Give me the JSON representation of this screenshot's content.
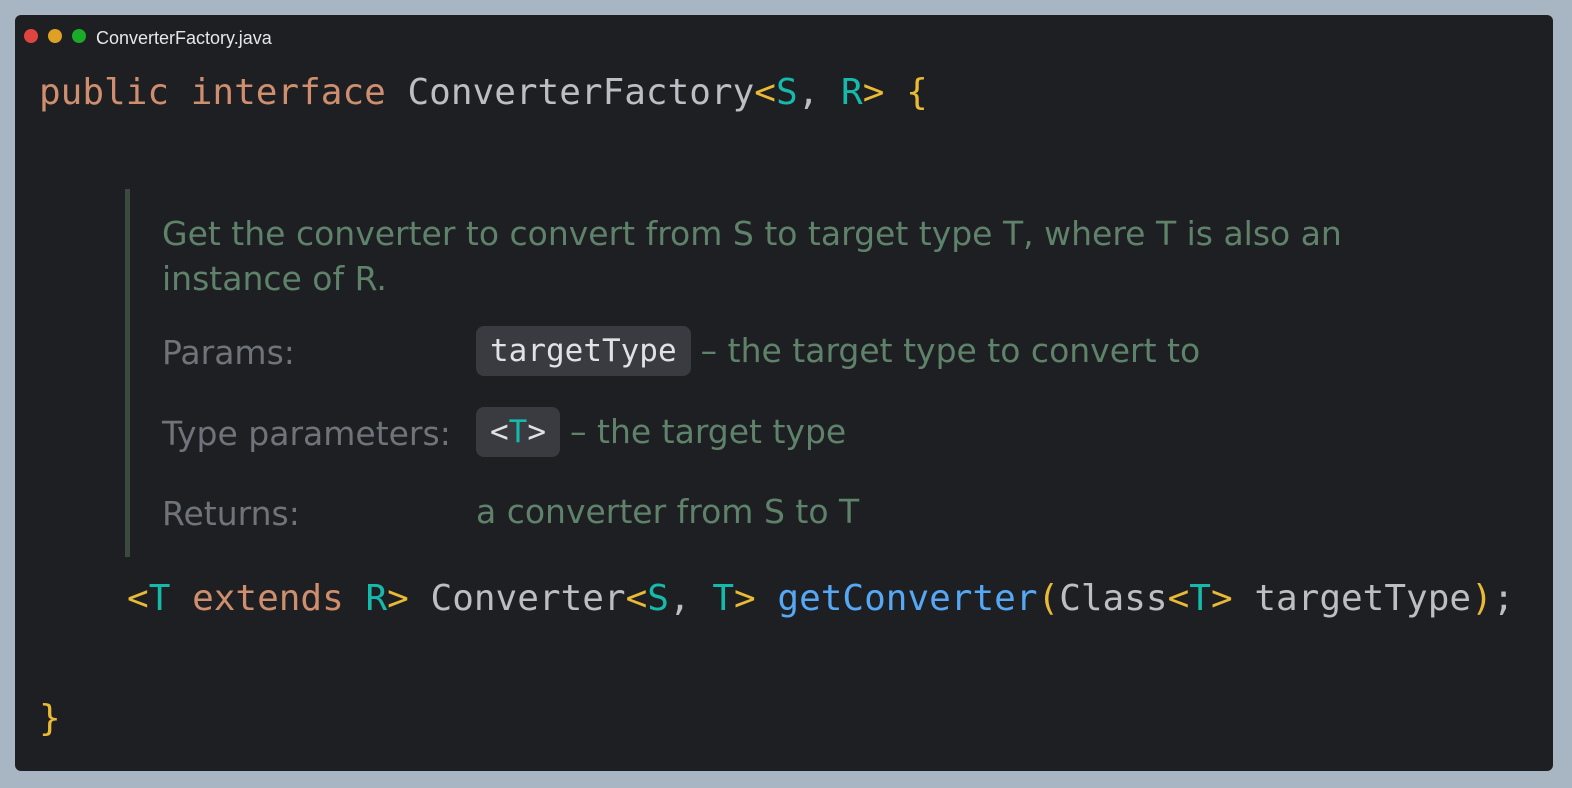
{
  "window": {
    "title": "ConverterFactory.java"
  },
  "code": {
    "line1": {
      "kw_public": "public",
      "kw_interface": "interface",
      "class_name": "ConverterFactory",
      "lt": "<",
      "type_s": "S",
      "comma": ", ",
      "type_r": "R",
      "gt": ">",
      "brace_open": "{"
    },
    "line2": {
      "lt1": "<",
      "type_t": "T",
      "kw_extends": "extends",
      "type_r": "R",
      "gt1": ">",
      "return_type": "Converter",
      "lt2": "<",
      "type_s": "S",
      "comma": ", ",
      "type_t2": "T",
      "gt2": ">",
      "method_name": "getConverter",
      "paren_open": "(",
      "param_type": "Class",
      "lt3": "<",
      "type_t3": "T",
      "gt3": ">",
      "param_name": "targetType",
      "paren_close": ")",
      "semicolon": ";"
    },
    "line3": {
      "brace_close": "}"
    }
  },
  "javadoc": {
    "description": "Get the converter to convert from S to target type T, where T is also an instance of R.",
    "params_label": "Params:",
    "params_chip": "targetType",
    "params_text": "– the target type to convert to",
    "type_params_label": "Type parameters:",
    "type_params_chip_lt": "<",
    "type_params_chip_t": "T",
    "type_params_chip_gt": ">",
    "type_params_text": "– the target type",
    "returns_label": "Returns:",
    "returns_text": "a converter from S to T"
  },
  "colors": {
    "background": "#1e1f22",
    "keyword": "#cf8e6d",
    "type_param": "#16baac",
    "bracket": "#e8ba36",
    "function": "#56a8f5",
    "doc_text": "#5f826b",
    "doc_label": "#6f737a"
  },
  "icons": [
    "close-dot-icon",
    "minimize-dot-icon",
    "maximize-dot-icon"
  ]
}
